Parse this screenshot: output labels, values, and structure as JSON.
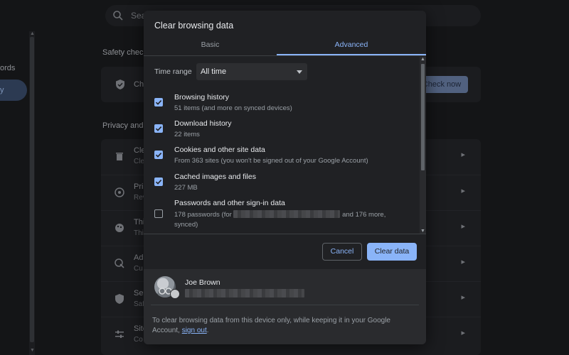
{
  "background": {
    "search_placeholder": "Sea",
    "nav_partial_text": "ords",
    "nav_active_partial": "y",
    "safety_check_title": "Safety chec",
    "safety_row_text": "Ch",
    "check_now_label": "Check now",
    "privacy_title": "Privacy and",
    "rows": [
      {
        "icon": "trash-icon",
        "t1": "Cle",
        "t2": "Cle"
      },
      {
        "icon": "cookie-icon",
        "t1": "Pri",
        "t2": "Rev"
      },
      {
        "icon": "palette-icon",
        "t1": "Thi",
        "t2": "Thi"
      },
      {
        "icon": "ads-icon",
        "t1": "Ad",
        "t2": "Cu"
      },
      {
        "icon": "shield-icon",
        "t1": "Sec",
        "t2": "Saf"
      },
      {
        "icon": "tune-icon",
        "t1": "Site",
        "t2": "Co"
      }
    ]
  },
  "dialog": {
    "title": "Clear browsing data",
    "tabs": [
      {
        "label": "Basic",
        "active": false
      },
      {
        "label": "Advanced",
        "active": true
      }
    ],
    "time_range": {
      "label": "Time range",
      "value": "All time"
    },
    "options": [
      {
        "title": "Browsing history",
        "subtitle": "51 items (and more on synced devices)",
        "checked": true
      },
      {
        "title": "Download history",
        "subtitle": "22 items",
        "checked": true
      },
      {
        "title": "Cookies and other site data",
        "subtitle": "From 363 sites (you won't be signed out of your Google Account)",
        "checked": true
      },
      {
        "title": "Cached images and files",
        "subtitle": "227 MB",
        "checked": true
      },
      {
        "title": "Passwords and other sign-in data",
        "subtitle_prefix": "178 passwords (for",
        "subtitle_suffix": "and 176 more,",
        "subtitle_line2": "synced)",
        "checked": false
      }
    ],
    "buttons": {
      "cancel": "Cancel",
      "clear": "Clear data"
    },
    "account": {
      "name": "Joe Brown",
      "note_text": "To clear browsing data from this device only, while keeping it in your Google Account,",
      "note_link": "sign out",
      "note_end": "."
    }
  },
  "colors": {
    "accent": "#8ab4f8",
    "dialog_bg": "#202124",
    "text_primary": "#e8eaed",
    "text_secondary": "#9aa0a6"
  }
}
